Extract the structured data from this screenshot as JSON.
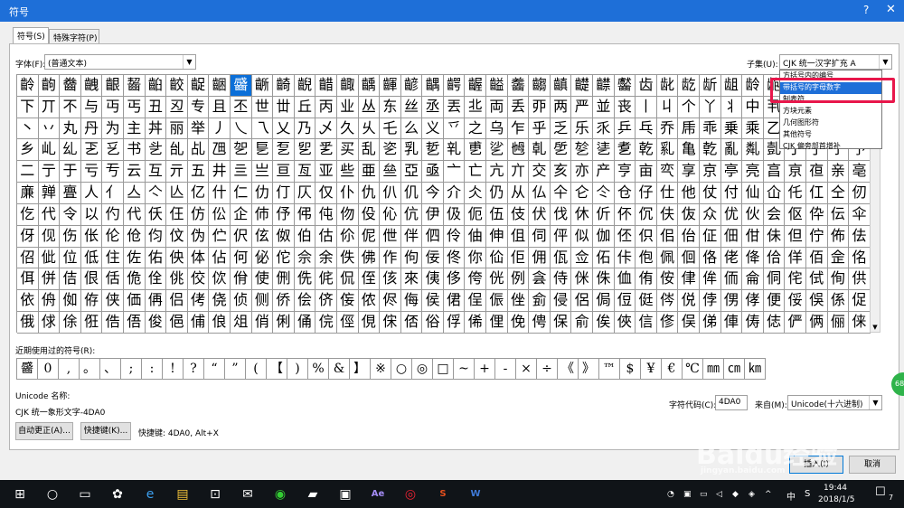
{
  "window": {
    "title": "符号",
    "help": "?",
    "close": "✕"
  },
  "tabs": [
    "符号(S)",
    "特殊字符(P)"
  ],
  "font": {
    "label": "字体(F):",
    "value": "(普通文本)"
  },
  "subset": {
    "label": "子集(U):",
    "value": "CJK 统一汉字扩充 A",
    "options": [
      "方括号内的编号",
      "带括号的字母数字",
      "制表符",
      "方块元素",
      "几何图形符",
      "其他符号",
      "CJK 偏旁部首增补"
    ],
    "selected_index": 1
  },
  "grid_rows": [
    "齡齣齤齥齦齧齨齩齪齫齬齭齮齯齰齱齲齳齴齵齶齷齸齹齺齻齼齽齾齿龀龁龂龃龄龅一丁丂七丄丅",
    "下丌不与丏丐丑丒专且丕世丗丘丙业丛东丝丞丟丠両丢丣两严並丧丨丩个丫丬中丮丯丰丱串丳临",
    "丶丷丸丹为主丼丽举丿乀乁乂乃乄久乆乇么义乊之乌乍乎乏乐乑乒乓乔乕乖乗乘乙乚乛乜九乞",
    "乡乢乣乤乥书乧乨乩乪乫乬乭乮乯买乱乲乳乴乵乶乷乸乹乺乻乼乽乾乿亀亁亂亃亄亅了亇予争",
    "二亍于亏亐云互亓五井亖亗亘亙亚些亜亝亞亟亠亡亢亣交亥亦产亨亩亪享京亭亮亯亰亱亲亳亴",
    "亷亸亹人亻亼亽亾亿什仁仂仃仄仅仆仇仈仉今介仌仍从仏仐仑仒仓仔仕他仗付仙仚仛仜仝仞仟",
    "仡代令以仢代仸仼仿伀企伂伃伄伅伆伇伈伉伊伋伌伍伎伏伐休伒伓伔伕伖众优伙会伛伜伝伞伟",
    "伢伣伤伥伦伧伨伩伪伫伬伭伮伯估伱伲伳伴伵伶伷伸伹伺伻似伽伾伿佀佁佂佃佄佅但佇佈佉佊",
    "佋佌位低住佐佑佒体佔何佖佗佘余佚佛作佝佞佟你佡佢佣佤佥佦佧佨佩佪佫佬佭佮佯佰佱佲佳",
    "佴併佶佷佸佹佺佻佼佽佾使侀侁侂侃侄侅來侇侈侉侊例侌侍侎侏侐侑侒侓侔侕侖侗侘侙侚供",
    "依侜侞侟侠価侢侣侤侥侦侧侨侩侪侫侬侭侮侯侰侱侲侳侴侵侶侷侸侹侺侻侼侽侾便俀俁係促",
    "俄俅俆俇俈俉俊俋俌俍俎俏俐俑俒俓俔俕俖俗俘俙俚俛俜保俞俟俠信俢俣俤俥俦俧俨俩俪俫"
  ],
  "selected_char": "䶠",
  "recent_label": "近期使用过的符号(R):",
  "recent": [
    "䶠",
    "0",
    ",",
    "。",
    "、",
    ";",
    ":",
    "!",
    "?",
    "“",
    "”",
    "(",
    "【",
    ")",
    "%",
    "&",
    "】",
    "※",
    "○",
    "◎",
    "□",
    "~",
    "+",
    "-",
    "×",
    "÷",
    "《",
    "》",
    "™",
    "$",
    "¥",
    "€",
    "℃",
    "㎜",
    "㎝",
    "㎞"
  ],
  "unicode_name_label": "Unicode 名称:",
  "unicode_name": "CJK 统一象形文字-4DA0",
  "char_code_label": "字符代码(C):",
  "char_code": "4DA0",
  "from_label": "来自(M):",
  "from_value": "Unicode(十六进制)",
  "buttons": {
    "autocorrect": "自动更正(A)...",
    "shortcut": "快捷键(K)...",
    "insert": "插入(I)",
    "cancel": "取消"
  },
  "shortcut_info": "快捷键: 4DA0, Alt+X",
  "taskbar": {
    "clock_time": "19:44",
    "clock_date": "2018/1/5",
    "ime": "中",
    "ime_mode": "S",
    "notify": "7",
    "apps": [
      "start-icon",
      "cortana-icon",
      "taskview-icon",
      "fan-icon",
      "edge-icon",
      "explorer-icon",
      "store-icon",
      "mail-icon",
      "360-icon",
      "folder-icon",
      "image-icon",
      "ae-icon",
      "music-icon",
      "s-icon",
      "word-icon"
    ]
  },
  "side_badge": "68",
  "watermark": {
    "main": "Baidu经验",
    "sub": "jingyan.baidu.com"
  }
}
